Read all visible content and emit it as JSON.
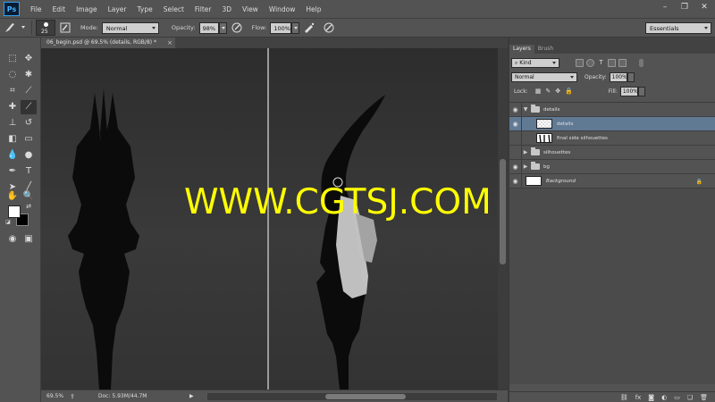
{
  "app": {
    "logo": "Ps"
  },
  "menu": [
    "File",
    "Edit",
    "Image",
    "Layer",
    "Type",
    "Select",
    "Filter",
    "3D",
    "View",
    "Window",
    "Help"
  ],
  "window_controls": [
    "minimize-icon",
    "restore-icon",
    "close-icon"
  ],
  "options": {
    "brush_size": "25",
    "mode_label": "Mode:",
    "mode_value": "Normal",
    "opacity_label": "Opacity:",
    "opacity_value": "98%",
    "flow_label": "Flow:",
    "flow_value": "100%",
    "workspace": "Essentials"
  },
  "document": {
    "tab_title": "06_begin.psd @ 69.5% (details, RGB/8) *",
    "close_label": "×",
    "watermark": "WWW.CGTSJ.COM",
    "zoom": "69.5%",
    "doc_size": "Doc: 5.93M/44.7M"
  },
  "colors": {
    "foreground": "#ffffff",
    "background": "#000000",
    "watermark": "#ffff00",
    "selection": "#617a94"
  },
  "layers_panel": {
    "tabs": [
      "Layers",
      "Brush"
    ],
    "filter_kind": "Kind",
    "blend_mode": "Normal",
    "opacity_label": "Opacity:",
    "opacity_value": "100%",
    "lock_label": "Lock:",
    "fill_label": "Fill:",
    "fill_value": "100%",
    "layers": [
      {
        "name": "details",
        "type": "group",
        "visible": true,
        "expanded": true
      },
      {
        "name": "details",
        "type": "layer",
        "visible": true,
        "selected": true
      },
      {
        "name": "final side silhouettes",
        "type": "layer",
        "visible": false
      },
      {
        "name": "silhouettes",
        "type": "group",
        "visible": false,
        "expanded": false
      },
      {
        "name": "bg",
        "type": "group",
        "visible": true,
        "expanded": false
      },
      {
        "name": "Background",
        "type": "background",
        "visible": true,
        "locked": true
      }
    ]
  }
}
